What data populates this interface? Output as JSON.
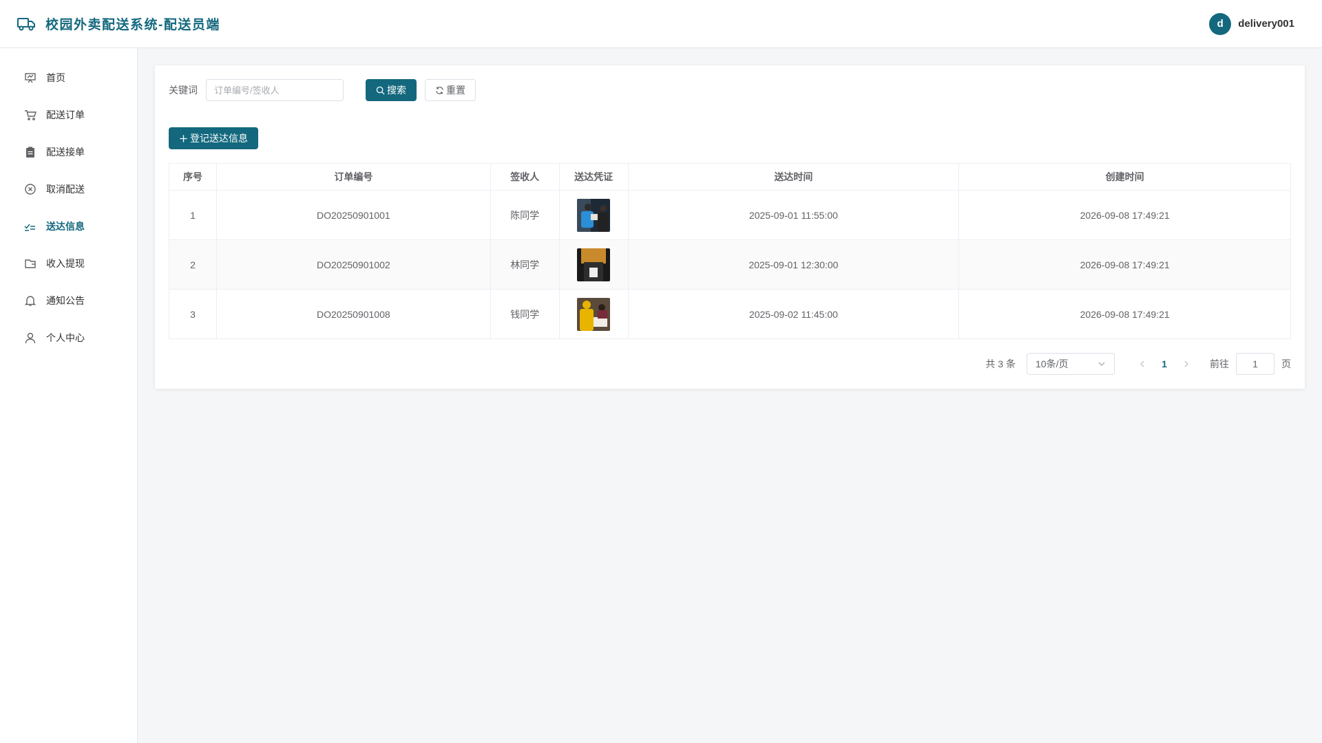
{
  "app": {
    "title": "校园外卖配送系统-配送员端"
  },
  "user": {
    "avatar_letter": "d",
    "name": "delivery001"
  },
  "sidebar": {
    "items": [
      {
        "label": "首页",
        "icon": "home-monitor-icon",
        "active": false
      },
      {
        "label": "配送订单",
        "icon": "cart-icon",
        "active": false
      },
      {
        "label": "配送接单",
        "icon": "clipboard-icon",
        "active": false
      },
      {
        "label": "取消配送",
        "icon": "circle-close-icon",
        "active": false
      },
      {
        "label": "送达信息",
        "icon": "checklist-icon",
        "active": true
      },
      {
        "label": "收入提现",
        "icon": "wallet-icon",
        "active": false
      },
      {
        "label": "通知公告",
        "icon": "bell-icon",
        "active": false
      },
      {
        "label": "个人中心",
        "icon": "user-icon",
        "active": false
      }
    ]
  },
  "search": {
    "label": "关键词",
    "placeholder": "订单编号/签收人",
    "value": "",
    "search_button": "搜索",
    "reset_button": "重置"
  },
  "actions": {
    "add_button": "登记送达信息"
  },
  "table": {
    "headers": [
      "序号",
      "订单编号",
      "签收人",
      "送达凭证",
      "送达时间",
      "创建时间"
    ],
    "rows": [
      {
        "index": "1",
        "order_no": "DO20250901001",
        "receiver": "陈同学",
        "delivered_at": "2025-09-01 11:55:00",
        "created_at": "2026-09-08 17:49:21"
      },
      {
        "index": "2",
        "order_no": "DO20250901002",
        "receiver": "林同学",
        "delivered_at": "2025-09-01 12:30:00",
        "created_at": "2026-09-08 17:49:21"
      },
      {
        "index": "3",
        "order_no": "DO20250901008",
        "receiver": "钱同学",
        "delivered_at": "2025-09-02 11:45:00",
        "created_at": "2026-09-08 17:49:21"
      }
    ]
  },
  "pagination": {
    "total": "共 3 条",
    "page_size": "10条/页",
    "current_page": "1",
    "goto_label": "前往",
    "goto_value": "1",
    "page_unit": "页"
  },
  "colors": {
    "brand": "#13687e"
  }
}
